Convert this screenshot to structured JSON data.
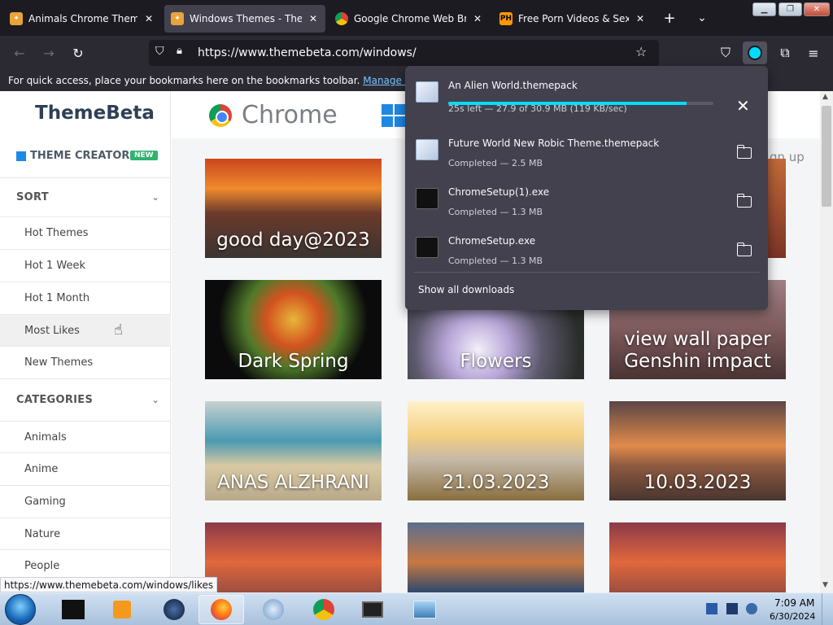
{
  "tabs": [
    {
      "title": "Animals Chrome Themes - ",
      "favicon": "themebeta-icon",
      "active": false
    },
    {
      "title": "Windows Themes - Theme",
      "favicon": "themebeta-icon",
      "active": true
    },
    {
      "title": "Google Chrome Web Bro",
      "favicon": "chrome-icon",
      "active": false
    },
    {
      "title": "Free Porn Videos & Sex Mo",
      "favicon": "ph-icon",
      "favicon_text": "PH",
      "active": false
    }
  ],
  "tabstrip": {
    "new_tab": "+",
    "list_all": "⌄",
    "close": "✕"
  },
  "navbar": {
    "url": "https://www.themebeta.com/windows/"
  },
  "bookmarks_bar": {
    "text": "For quick access, place your bookmarks here on the bookmarks toolbar.",
    "link": "Manage bookmarks…"
  },
  "sidebar": {
    "logo": "ThemeBeta",
    "theme_creator": "THEME CREATOR",
    "new_badge": "NEW",
    "sort_heading": "SORT",
    "sort_items": [
      "Hot Themes",
      "Hot 1 Week",
      "Hot 1 Month",
      "Most Likes",
      "New Themes"
    ],
    "categories_heading": "CATEGORIES",
    "category_items": [
      "Animals",
      "Anime",
      "Gaming",
      "Nature",
      "People"
    ]
  },
  "platform": {
    "chrome": "Chrome"
  },
  "header": {
    "signup": "gn up"
  },
  "cards": [
    {
      "caption": "good day@2023"
    },
    {
      "caption": "Dark Spring"
    },
    {
      "caption": "Flowers"
    },
    {
      "caption": "view wall paper Genshin impact"
    },
    {
      "caption": "ANAS ALZHRANI"
    },
    {
      "caption": "21.03.2023"
    },
    {
      "caption": "10.03.2023"
    },
    {
      "caption": ""
    },
    {
      "caption": ""
    },
    {
      "caption": ""
    }
  ],
  "downloads": {
    "items": [
      {
        "name": "An Alien World.themepack",
        "status": "25s left — 27.9 of 30.9 MB (119 KB/sec)",
        "progress": 0.9,
        "icon": "themepack-icon"
      },
      {
        "name": "Future World New Robic Theme.themepack",
        "status": "Completed — 2.5 MB",
        "icon": "themepack-icon"
      },
      {
        "name": "ChromeSetup(1).exe",
        "status": "Completed — 1.3 MB",
        "icon": "exe-icon"
      },
      {
        "name": "ChromeSetup.exe",
        "status": "Completed — 1.3 MB",
        "icon": "exe-icon"
      }
    ],
    "show_all": "Show all downloads"
  },
  "status_url": "https://www.themebeta.com/windows/likes",
  "taskbar": {
    "time": "7:09 AM",
    "date": "6/30/2024"
  },
  "colors": {
    "accent": "#00ddff",
    "new_badge": "#2fb36e",
    "brand": "#2e4055"
  }
}
